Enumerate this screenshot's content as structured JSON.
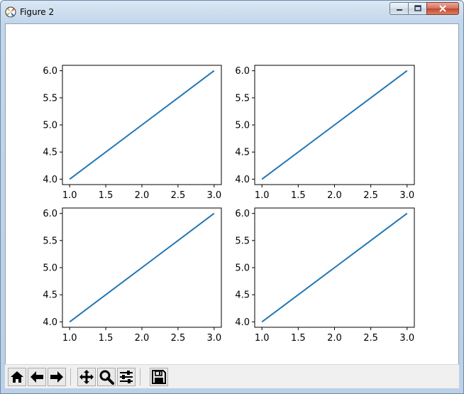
{
  "window": {
    "title": "Figure 2"
  },
  "toolbar": {
    "buttons": [
      {
        "name": "home-button",
        "icon": "home-icon"
      },
      {
        "name": "back-button",
        "icon": "left-arrow-icon"
      },
      {
        "name": "forward-button",
        "icon": "right-arrow-icon"
      },
      {
        "name": "pan-button",
        "icon": "move-arrows-icon"
      },
      {
        "name": "zoom-button",
        "icon": "magnifier-icon"
      },
      {
        "name": "configure-subplots-button",
        "icon": "sliders-icon"
      },
      {
        "name": "save-button",
        "icon": "floppy-disk-icon"
      }
    ]
  },
  "chart_data": [
    {
      "type": "line",
      "title": "",
      "xlabel": "",
      "ylabel": "",
      "x": [
        1,
        2,
        3
      ],
      "series": [
        {
          "values": [
            4,
            5,
            6
          ],
          "color": "#1f77b4"
        }
      ],
      "xlim": [
        0.9,
        3.1
      ],
      "ylim": [
        3.9,
        6.1
      ],
      "xticks": [
        "1.0",
        "1.5",
        "2.0",
        "2.5",
        "3.0"
      ],
      "yticks": [
        "4.0",
        "4.5",
        "5.0",
        "5.5",
        "6.0"
      ],
      "grid": false
    },
    {
      "type": "line",
      "title": "",
      "xlabel": "",
      "ylabel": "",
      "x": [
        1,
        2,
        3
      ],
      "series": [
        {
          "values": [
            4,
            5,
            6
          ],
          "color": "#1f77b4"
        }
      ],
      "xlim": [
        0.9,
        3.1
      ],
      "ylim": [
        3.9,
        6.1
      ],
      "xticks": [
        "1.0",
        "1.5",
        "2.0",
        "2.5",
        "3.0"
      ],
      "yticks": [
        "4.0",
        "4.5",
        "5.0",
        "5.5",
        "6.0"
      ],
      "grid": false
    },
    {
      "type": "line",
      "title": "",
      "xlabel": "",
      "ylabel": "",
      "x": [
        1,
        2,
        3
      ],
      "series": [
        {
          "values": [
            4,
            5,
            6
          ],
          "color": "#1f77b4"
        }
      ],
      "xlim": [
        0.9,
        3.1
      ],
      "ylim": [
        3.9,
        6.1
      ],
      "xticks": [
        "1.0",
        "1.5",
        "2.0",
        "2.5",
        "3.0"
      ],
      "yticks": [
        "4.0",
        "4.5",
        "5.0",
        "5.5",
        "6.0"
      ],
      "grid": false
    },
    {
      "type": "line",
      "title": "",
      "xlabel": "",
      "ylabel": "",
      "x": [
        1,
        2,
        3
      ],
      "series": [
        {
          "values": [
            4,
            5,
            6
          ],
          "color": "#1f77b4"
        }
      ],
      "xlim": [
        0.9,
        3.1
      ],
      "ylim": [
        3.9,
        6.1
      ],
      "xticks": [
        "1.0",
        "1.5",
        "2.0",
        "2.5",
        "3.0"
      ],
      "yticks": [
        "4.0",
        "4.5",
        "5.0",
        "5.5",
        "6.0"
      ],
      "grid": false
    }
  ]
}
